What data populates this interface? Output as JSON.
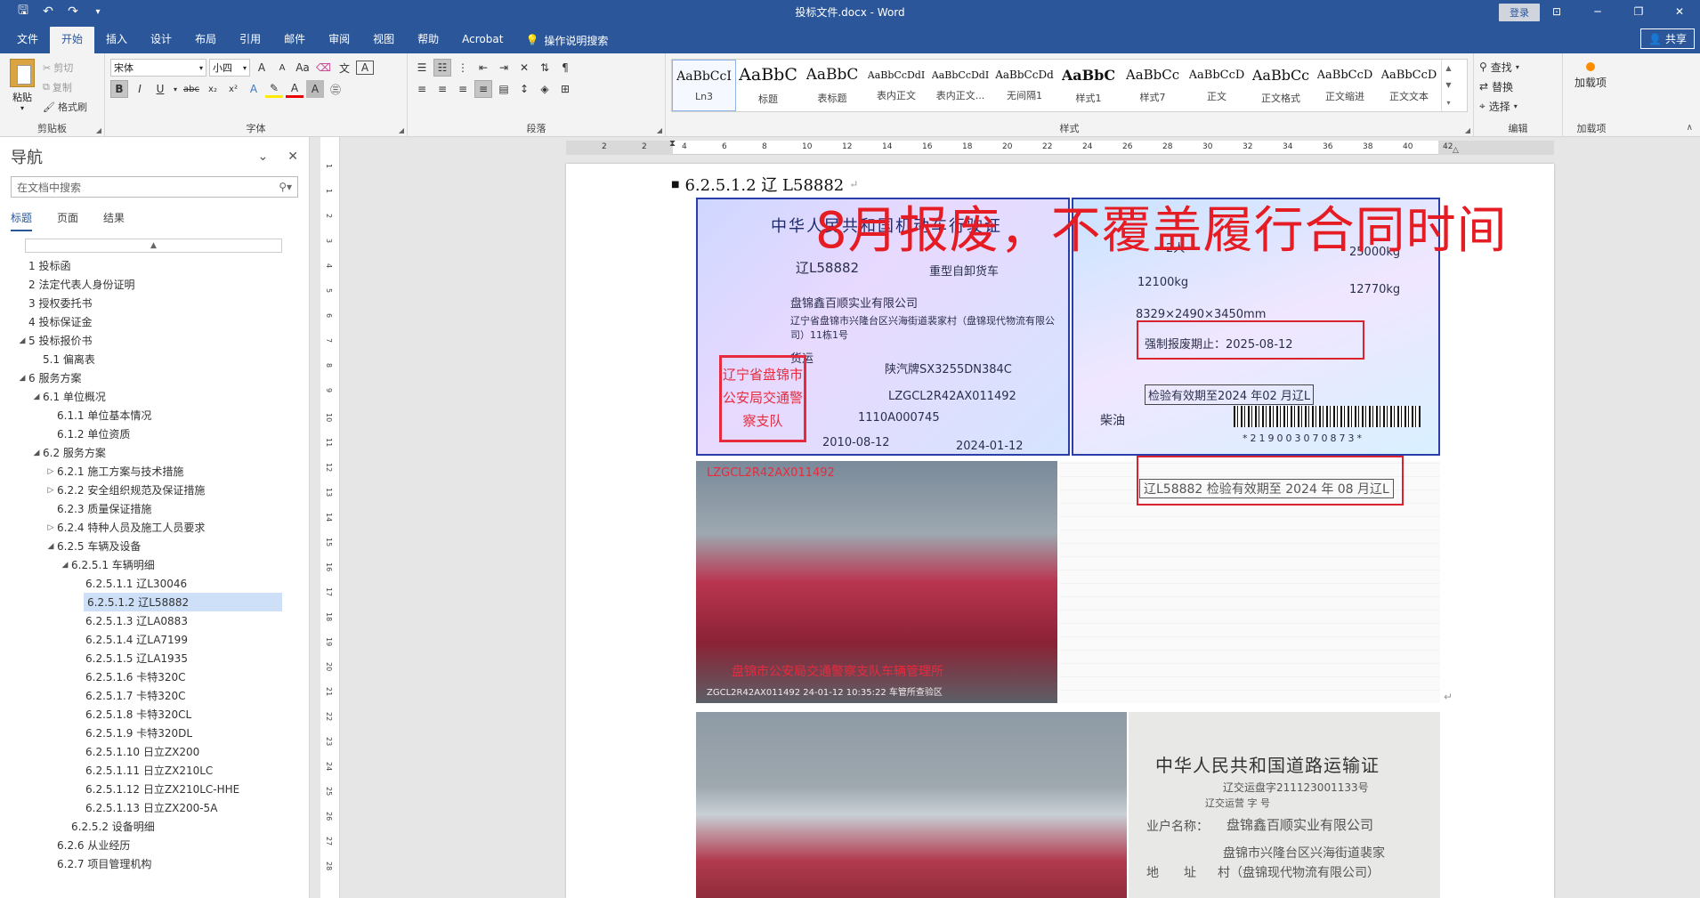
{
  "titlebar": {
    "doc_title": "投标文件.docx  -  Word",
    "login": "登录",
    "qat": [
      "save-icon",
      "undo-icon",
      "redo-icon",
      "customize-icon"
    ]
  },
  "tabs": [
    "文件",
    "开始",
    "插入",
    "设计",
    "布局",
    "引用",
    "邮件",
    "审阅",
    "视图",
    "帮助",
    "Acrobat"
  ],
  "active_tab": "开始",
  "tellme": "操作说明搜索",
  "share": "共享",
  "ribbon": {
    "clipboard": {
      "paste": "粘贴",
      "cut": "剪切",
      "copy": "复制",
      "format_painter": "格式刷",
      "label": "剪贴板"
    },
    "font": {
      "name": "宋体",
      "size": "小四",
      "label": "字体",
      "grow": "A",
      "shrink": "A",
      "case": "Aa"
    },
    "paragraph": {
      "label": "段落"
    },
    "styles": {
      "label": "样式",
      "items": [
        {
          "preview": "AaBbCcI",
          "name": "Ln3"
        },
        {
          "preview": "AaBbC",
          "name": "标题"
        },
        {
          "preview": "AaBbC",
          "name": "表标题"
        },
        {
          "preview": "AaBbCcDdI",
          "name": "表内正文"
        },
        {
          "preview": "AaBbCcDdI",
          "name": "表内正文..."
        },
        {
          "preview": "AaBbCcDd",
          "name": "无间隔1"
        },
        {
          "preview": "AaBbC",
          "name": "样式1"
        },
        {
          "preview": "AaBbCc",
          "name": "样式7"
        },
        {
          "preview": "AaBbCcD",
          "name": "正文"
        },
        {
          "preview": "AaBbCc",
          "name": "正文格式"
        },
        {
          "preview": "AaBbCcD",
          "name": "正文缩进"
        },
        {
          "preview": "AaBbCcD",
          "name": "正文文本"
        }
      ]
    },
    "editing": {
      "find": "查找",
      "replace": "替换",
      "select": "选择",
      "label": "编辑"
    },
    "addins": {
      "button": "加载项",
      "label": "加载项"
    }
  },
  "nav": {
    "title": "导航",
    "search_placeholder": "在文档中搜索",
    "tabs": [
      "标题",
      "页面",
      "结果"
    ],
    "active_tab": "标题",
    "headings": [
      {
        "text": "1 投标函",
        "level": 1,
        "tw": ""
      },
      {
        "text": "2 法定代表人身份证明",
        "level": 1,
        "tw": ""
      },
      {
        "text": "3 授权委托书",
        "level": 1,
        "tw": ""
      },
      {
        "text": "4 投标保证金",
        "level": 1,
        "tw": ""
      },
      {
        "text": "5 投标报价书",
        "level": 1,
        "tw": "◢"
      },
      {
        "text": "5.1 偏离表",
        "level": 2,
        "tw": ""
      },
      {
        "text": "6 服务方案",
        "level": 1,
        "tw": "◢"
      },
      {
        "text": "6.1 单位概况",
        "level": 2,
        "tw": "◢"
      },
      {
        "text": "6.1.1 单位基本情况",
        "level": 3,
        "tw": ""
      },
      {
        "text": "6.1.2 单位资质",
        "level": 3,
        "tw": ""
      },
      {
        "text": "6.2 服务方案",
        "level": 2,
        "tw": "◢"
      },
      {
        "text": "6.2.1 施工方案与技术措施",
        "level": 4,
        "tw": "▷"
      },
      {
        "text": "6.2.2 安全组织规范及保证措施",
        "level": 4,
        "tw": "▷"
      },
      {
        "text": "6.2.3 质量保证措施",
        "level": 3,
        "tw": ""
      },
      {
        "text": "6.2.4 特种人员及施工人员要求",
        "level": 4,
        "tw": "▷"
      },
      {
        "text": "6.2.5 车辆及设备",
        "level": 4,
        "tw": "◢"
      },
      {
        "text": "6.2.5.1 车辆明细",
        "level": 5,
        "tw": "◢"
      },
      {
        "text": "6.2.5.1.1 辽L30046",
        "level": 6,
        "tw": ""
      },
      {
        "text": "6.2.5.1.2 辽L58882",
        "level": 6,
        "tw": "",
        "current": true
      },
      {
        "text": "6.2.5.1.3 辽LA0883",
        "level": 6,
        "tw": ""
      },
      {
        "text": "6.2.5.1.4 辽LA7199",
        "level": 6,
        "tw": ""
      },
      {
        "text": "6.2.5.1.5 辽LA1935",
        "level": 6,
        "tw": ""
      },
      {
        "text": "6.2.5.1.6 卡特320C",
        "level": 6,
        "tw": ""
      },
      {
        "text": "6.2.5.1.7 卡特320C",
        "level": 6,
        "tw": ""
      },
      {
        "text": "6.2.5.1.8 卡特320CL",
        "level": 6,
        "tw": ""
      },
      {
        "text": "6.2.5.1.9 卡特320DL",
        "level": 6,
        "tw": ""
      },
      {
        "text": "6.2.5.1.10 日立ZX200",
        "level": 6,
        "tw": ""
      },
      {
        "text": "6.2.5.1.11 日立ZX210LC",
        "level": 6,
        "tw": ""
      },
      {
        "text": "6.2.5.1.12 日立ZX210LC-HHE",
        "level": 6,
        "tw": ""
      },
      {
        "text": "6.2.5.1.13 日立ZX200-5A",
        "level": 6,
        "tw": ""
      },
      {
        "text": "6.2.5.2 设备明细",
        "level": 5,
        "tw": ""
      },
      {
        "text": "6.2.6 从业经历",
        "level": 3,
        "tw": ""
      },
      {
        "text": "6.2.7 项目管理机构",
        "level": 3,
        "tw": ""
      }
    ]
  },
  "ruler": {
    "h_ticks": [
      "2",
      "2",
      "4",
      "6",
      "8",
      "10",
      "12",
      "14",
      "16",
      "18",
      "20",
      "22",
      "24",
      "26",
      "28",
      "30",
      "32",
      "34",
      "36",
      "38",
      "40",
      "42"
    ],
    "v_ticks": [
      "1",
      "1",
      "2",
      "3",
      "4",
      "5",
      "6",
      "7",
      "8",
      "9",
      "10",
      "11",
      "12",
      "13",
      "14",
      "15",
      "16",
      "17",
      "18",
      "19",
      "20",
      "21",
      "22",
      "23",
      "24",
      "25",
      "26",
      "27",
      "28"
    ]
  },
  "document": {
    "heading": "6.2.5.1.2  辽 L58882",
    "annotation": "8月报废，不覆盖履行合同时间",
    "license": {
      "title": "中华人民共和国机动车行驶证",
      "plate": "辽L58882",
      "vehicle_type": "重型自卸货车",
      "owner": "盘锦鑫百顺实业有限公司",
      "address": "辽宁省盘锦市兴隆台区兴海街道裴家村（盘锦现代物流有限公司）11栋1号",
      "use": "货运",
      "model": "陕汽牌SX3255DN384C",
      "vin": "LZGCL2R42AX011492",
      "engine": "1110A000745",
      "register_date": "2010-08-12",
      "issue_date": "2024-01-12",
      "stamp": "辽宁省盘锦市公安局交通警察支队"
    },
    "license_back": {
      "passengers": "2人",
      "total_mass": "25000kg",
      "curb_mass": "12100kg",
      "load": "12770kg",
      "dimensions": "8329×2490×3450mm",
      "scrap_date": "强制报废期止：2025-08-12",
      "inspection": "检验有效期至2024 年02 月辽L",
      "fuel": "柴油",
      "barcode": "*219003070873*"
    },
    "truck_photo": {
      "top": "LZGCL2R42AX011492",
      "bottom": "盘锦市公安局交通警察支队车辆管理所",
      "caption": "ZGCL2R42AX011492 24-01-12 10:35:22 车管所查验区"
    },
    "inspection_stamp": "辽L58882 检验有效期至 2024 年 08 月辽L",
    "transport_cert": {
      "title": "中华人民共和国道路运输证",
      "number": "辽交运盘字211123001133号",
      "org": "辽交运营  字  号",
      "owner_label": "业户名称：",
      "owner": "盘锦鑫百顺实业有限公司",
      "addr_label": "地　　址",
      "addr1": "盘锦市兴隆台区兴海街道裴家",
      "addr2": "村（盘锦现代物流有限公司）"
    }
  }
}
